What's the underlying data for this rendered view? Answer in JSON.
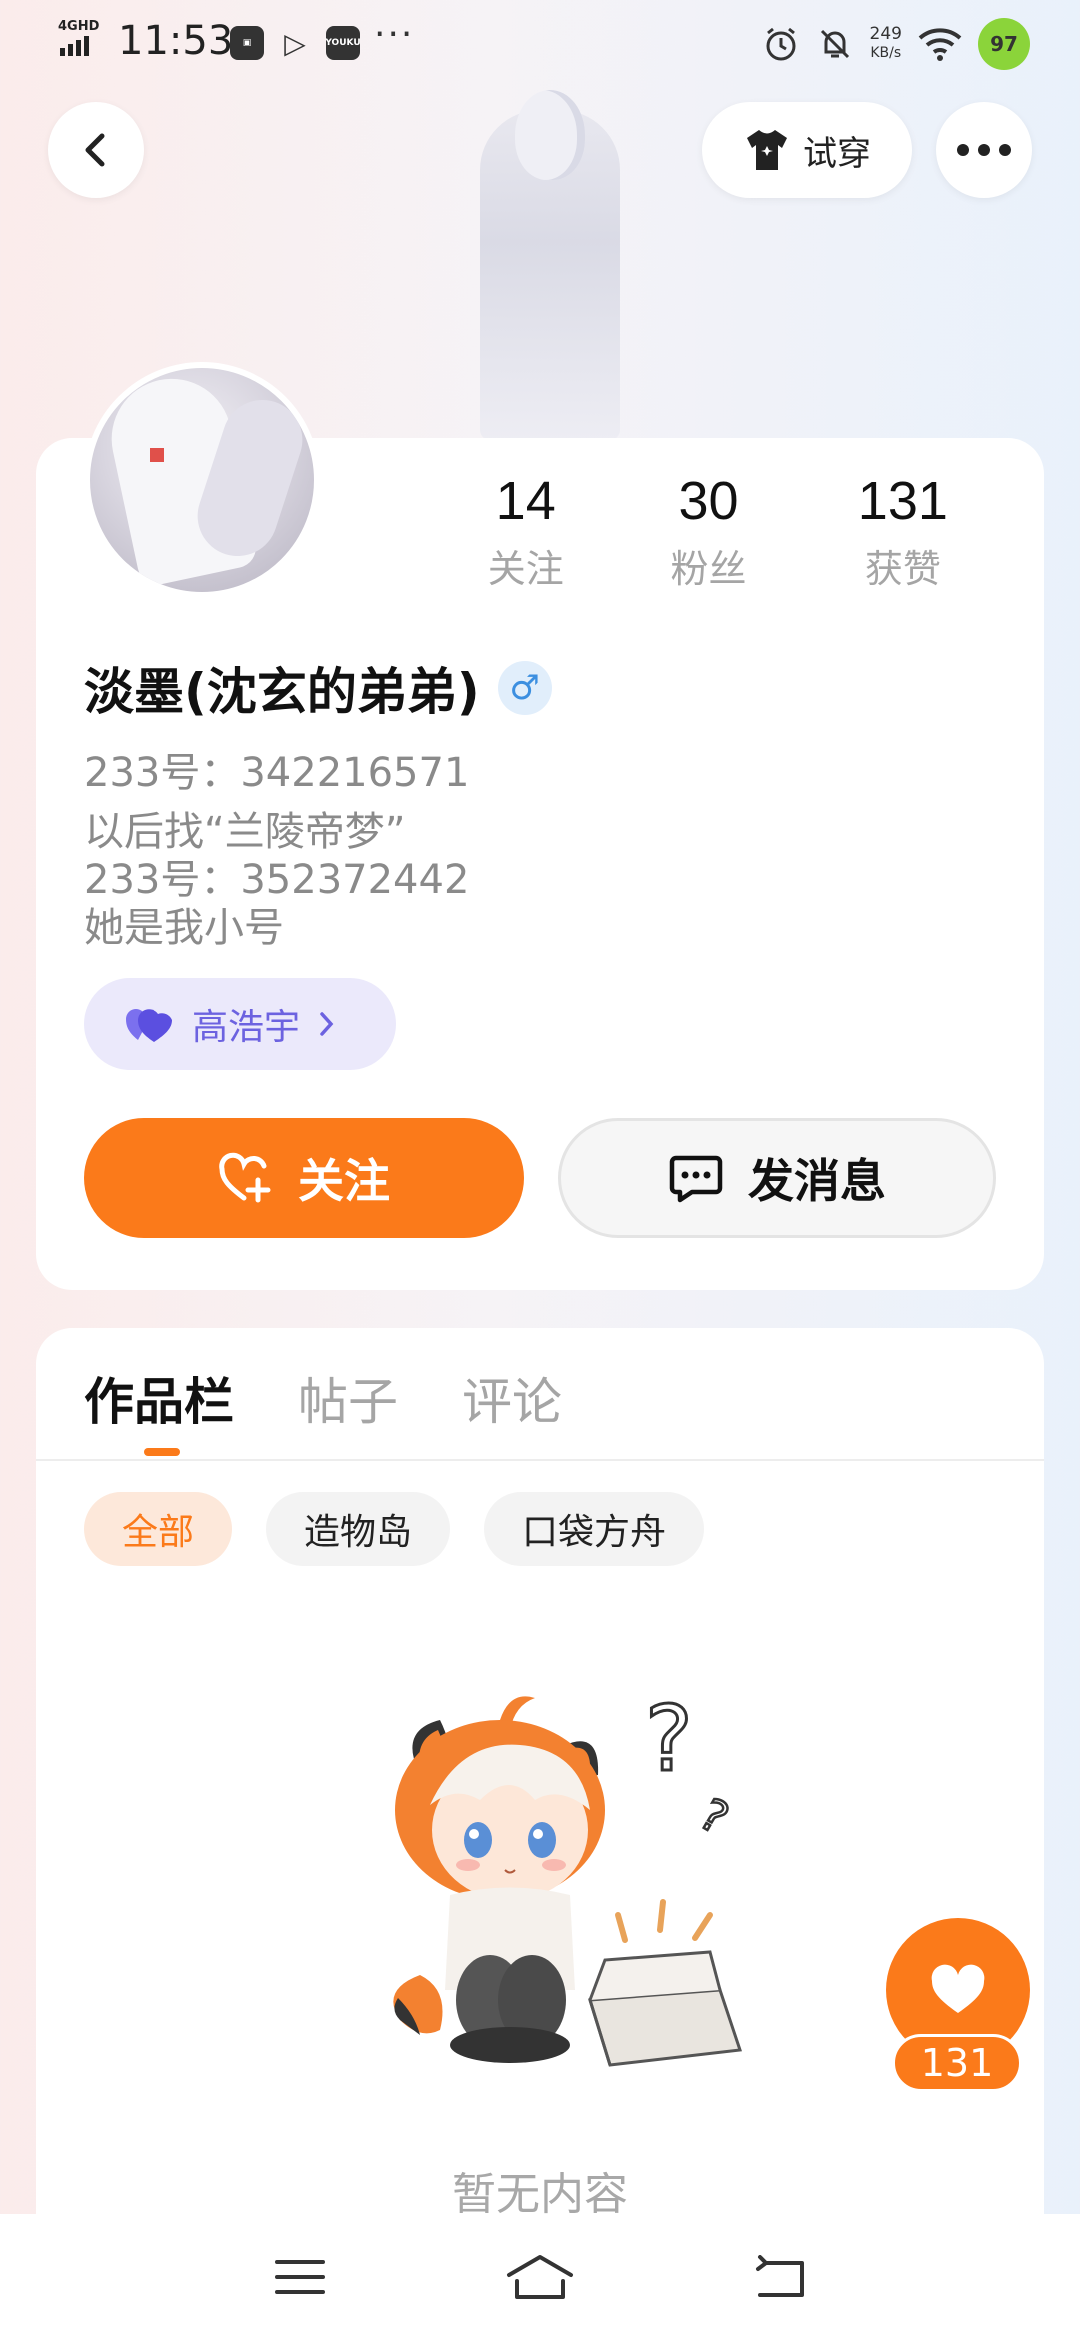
{
  "status_bar": {
    "network": "4GHD",
    "time": "11:53",
    "app_icons": [
      "YOUKU"
    ],
    "more": "···",
    "speed_value": "249",
    "speed_unit": "KB/s",
    "battery": "97"
  },
  "header": {
    "try_on_label": "试穿"
  },
  "profile": {
    "username": "淡墨(沈玄的弟弟)",
    "gender_symbol": "♂",
    "uid": "233号：342216571",
    "bio_lines": [
      "以后找“兰陵帝梦”",
      "233号：352372442",
      "她是我小号"
    ],
    "guild_name": "高浩宇",
    "stats": [
      {
        "value": "14",
        "label": "关注"
      },
      {
        "value": "30",
        "label": "粉丝"
      },
      {
        "value": "131",
        "label": "获赞"
      }
    ],
    "follow_label": "关注",
    "message_label": "发消息"
  },
  "works": {
    "tabs": [
      "作品栏",
      "帖子",
      "评论"
    ],
    "active_tab": "作品栏",
    "filters": [
      "全部",
      "造物岛",
      "口袋方舟"
    ],
    "active_filter": "全部",
    "empty_text": "暂无内容"
  },
  "floating_like": {
    "count": "131"
  },
  "colors": {
    "accent": "#fb7a1a",
    "guild": "#6c62e0",
    "gender": "#3c8fe0"
  },
  "icons": [
    "back-icon",
    "tshirt-icon",
    "more-icon",
    "heart-plus-icon",
    "chat-icon",
    "guild-heart-icon",
    "heart-icon",
    "menu-icon",
    "home-icon",
    "return-icon"
  ]
}
